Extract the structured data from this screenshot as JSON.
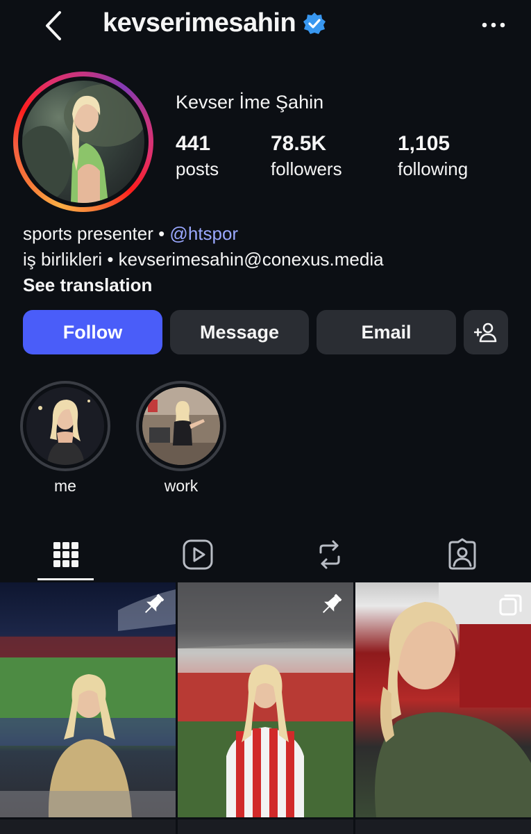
{
  "header": {
    "username": "kevserimesahin",
    "verified": true
  },
  "profile": {
    "display_name": "Kevser İme Şahin",
    "stats": [
      {
        "value": "441",
        "label": "posts"
      },
      {
        "value": "78.5K",
        "label": "followers"
      },
      {
        "value": "1,105",
        "label": "following"
      }
    ],
    "bio": {
      "line1_text": "sports presenter • ",
      "line1_mention": "@htspor",
      "line2": "iş birlikleri • kevserimesahin@conexus.media",
      "see_translation": "See translation"
    }
  },
  "actions": {
    "follow": "Follow",
    "message": "Message",
    "email": "Email"
  },
  "highlights": [
    {
      "label": "me"
    },
    {
      "label": "work"
    }
  ],
  "tabs": [
    {
      "icon": "grid-icon",
      "active": true
    },
    {
      "icon": "reels-icon",
      "active": false
    },
    {
      "icon": "reposts-icon",
      "active": false
    },
    {
      "icon": "tagged-icon",
      "active": false
    }
  ],
  "colors": {
    "background": "#0c0f14",
    "follow_button": "#4a5df9",
    "secondary_button": "#2a2d33",
    "mention": "#9aa8ff",
    "verified_badge": "#3897f0"
  }
}
